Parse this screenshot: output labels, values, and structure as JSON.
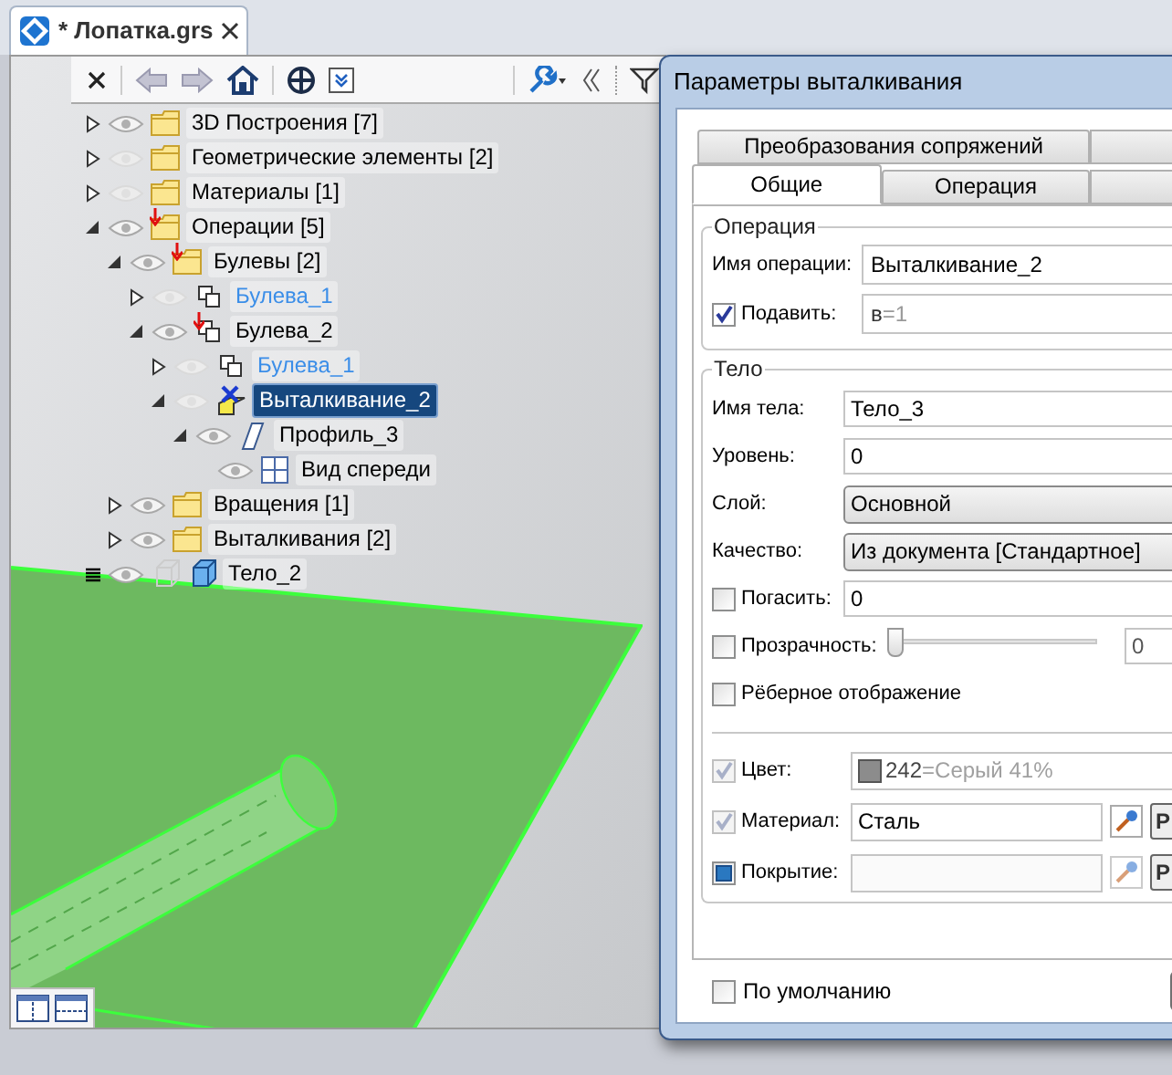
{
  "document_tab": {
    "title": "* Лопатка.grs"
  },
  "tree": [
    {
      "kind": "folder",
      "label": "3D Построения [7]",
      "expanded": false,
      "visible": true,
      "flag": false,
      "linked": false,
      "selected": false
    },
    {
      "kind": "folder",
      "label": "Геометрические элементы [2]",
      "expanded": false,
      "visible": false,
      "flag": false,
      "linked": false,
      "selected": false
    },
    {
      "kind": "folder",
      "label": "Материалы [1]",
      "expanded": false,
      "visible": false,
      "flag": false,
      "linked": false,
      "selected": false
    },
    {
      "kind": "folder",
      "label": "Операции [5]",
      "expanded": true,
      "visible": true,
      "flag": true,
      "linked": false,
      "selected": false,
      "children": [
        {
          "kind": "folder",
          "label": "Булевы [2]",
          "expanded": true,
          "visible": true,
          "flag": true,
          "linked": false,
          "selected": false,
          "children": [
            {
              "kind": "boolean",
              "label": "Булева_1",
              "expanded": false,
              "visible": false,
              "flag": false,
              "linked": true,
              "selected": false
            },
            {
              "kind": "boolean",
              "label": "Булева_2",
              "expanded": true,
              "visible": true,
              "flag": true,
              "linked": false,
              "selected": false,
              "children": [
                {
                  "kind": "boolean",
                  "label": "Булева_1",
                  "expanded": false,
                  "visible": false,
                  "flag": false,
                  "linked": true,
                  "selected": false
                },
                {
                  "kind": "extrude",
                  "label": "Выталкивание_2",
                  "expanded": true,
                  "visible": false,
                  "flag": false,
                  "linked": false,
                  "selected": true,
                  "children": [
                    {
                      "kind": "profile",
                      "label": "Профиль_3",
                      "expanded": true,
                      "visible": true,
                      "flag": false,
                      "linked": false,
                      "selected": false,
                      "children": [
                        {
                          "kind": "view",
                          "label": "Вид спереди",
                          "visible": true,
                          "flag": false,
                          "linked": false,
                          "selected": false
                        }
                      ]
                    }
                  ]
                }
              ]
            }
          ]
        },
        {
          "kind": "folder",
          "label": "Вращения [1]",
          "expanded": false,
          "visible": true,
          "flag": false,
          "linked": false,
          "selected": false
        },
        {
          "kind": "folder",
          "label": "Выталкивания [2]",
          "expanded": false,
          "visible": true,
          "flag": false,
          "linked": false,
          "selected": false
        }
      ]
    },
    {
      "kind": "body",
      "label": "Тело_2",
      "visible": true,
      "flag": false,
      "linked": false,
      "selected": false
    }
  ],
  "dialog": {
    "title": "Параметры выталкивания",
    "tabs_back": [
      {
        "label": "Преобразования сопряжений",
        "selected": false
      }
    ],
    "tabs": [
      {
        "label": "Общие",
        "selected": true
      },
      {
        "label": "Операция",
        "selected": false
      }
    ],
    "operation_group": {
      "title": "Операция",
      "name_label": "Имя операции:",
      "name_value": "Выталкивание_2",
      "suppress_label": "Подавить:",
      "suppress_checked": true,
      "suppress_value": "в",
      "suppress_suffix": "=1"
    },
    "body_group": {
      "title": "Тело",
      "rows": [
        {
          "kind": "text",
          "label": "Имя тела:",
          "value": "Тело_3"
        },
        {
          "kind": "text",
          "label": "Уровень:",
          "value": "0"
        },
        {
          "kind": "combo",
          "label": "Слой:",
          "value": "Основной"
        },
        {
          "kind": "combo",
          "label": "Качество:",
          "value": "Из документа [Стандартное]"
        },
        {
          "kind": "check_text",
          "label": "Погасить:",
          "checked": false,
          "value": "0"
        },
        {
          "kind": "check_slider",
          "label": "Прозрачность:",
          "checked": false,
          "level": 0,
          "value": "0"
        },
        {
          "kind": "check",
          "label": "Рёберное отображение",
          "checked": false
        }
      ],
      "appearance": [
        {
          "kind": "color",
          "label": "Цвет:",
          "checked": true,
          "disabled": true,
          "color": "#8c8c8c",
          "value": "242",
          "suffix": "=Серый 41%"
        },
        {
          "kind": "material",
          "label": "Материал:",
          "checked": true,
          "disabled": true,
          "value": "Сталь",
          "button": "Р"
        },
        {
          "kind": "material",
          "label": "Покрытие:",
          "checked": false,
          "disabled": false,
          "indeterminate": true,
          "button": "Р"
        }
      ]
    },
    "defaults": {
      "label": "По умолчанию",
      "checked": false
    }
  }
}
